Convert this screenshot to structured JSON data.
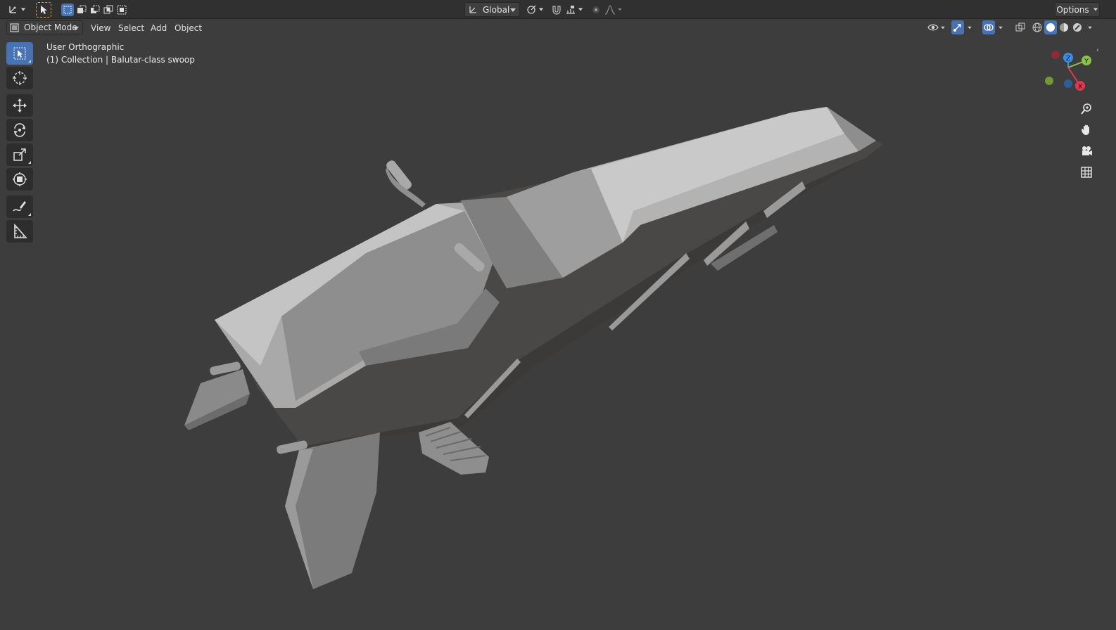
{
  "header": {
    "transform_orientation": "Global",
    "options_label": "Options"
  },
  "mode_bar": {
    "mode": "Object Mode",
    "menus": [
      "View",
      "Select",
      "Add",
      "Object"
    ]
  },
  "viewport": {
    "view_name": "User Orthographic",
    "collection_info": "(1) Collection | Balutar-class swoop"
  },
  "gizmo": {
    "axes": [
      "Z",
      "Y",
      "X"
    ],
    "colors": {
      "x": "#e4384f",
      "y": "#8bc34a",
      "z": "#3a8ee6"
    }
  },
  "tools": [
    "select-box-icon",
    "cursor-icon",
    "move-icon",
    "rotate-icon",
    "scale-icon",
    "transform-icon",
    "annotate-icon",
    "measure-icon"
  ],
  "colors": {
    "accent": "#4772b3",
    "background": "#3d3d3d",
    "header": "#303030"
  }
}
